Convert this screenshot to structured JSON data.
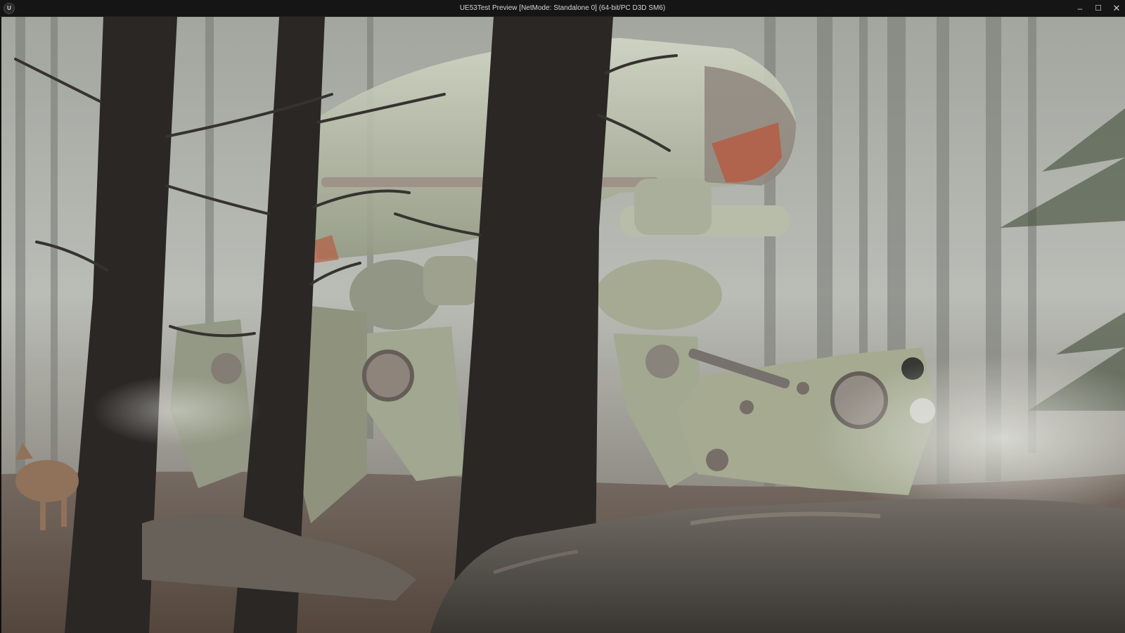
{
  "window": {
    "title": "UE53Test Preview [NetMode: Standalone 0]  (64-bit/PC D3D SM6)",
    "logo_icon": "unreal-engine-logo-icon",
    "logo_glyph": "U",
    "controls": {
      "minimize_icon": "minimize-icon",
      "minimize_glyph": "–",
      "maximize_icon": "maximize-icon",
      "maximize_glyph": "☐",
      "close_icon": "close-icon",
      "close_glyph": "✕"
    }
  },
  "viewport": {
    "scene": "game-render-forest-mech",
    "colors": {
      "fog": "#b9bcb6",
      "tree_trunk": "#1d1a18",
      "mech_body": "#a9b19a",
      "mech_accent": "#b4553a",
      "rock": "#4a4540",
      "ground": "#5a4a3e"
    }
  }
}
